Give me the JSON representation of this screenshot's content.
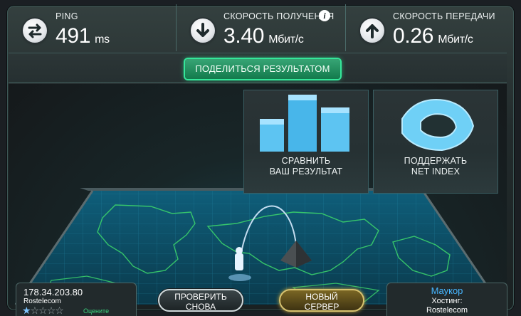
{
  "stats": {
    "ping": {
      "label": "PING",
      "value": "491",
      "unit": "ms",
      "icon": "swap-arrows-icon"
    },
    "download": {
      "label": "СКОРОСТЬ ПОЛУЧЕНИЯ",
      "value": "3.40",
      "unit": "Мбит/с",
      "icon": "arrow-down-icon",
      "info": "i"
    },
    "upload": {
      "label": "СКОРОСТЬ ПЕРЕДАЧИ",
      "value": "0.26",
      "unit": "Мбит/с",
      "icon": "arrow-up-icon"
    }
  },
  "share": {
    "label": "ПОДЕЛИТЬСЯ РЕЗУЛЬТАТОМ"
  },
  "tiles": {
    "compare": {
      "line1": "СРАВНИТЬ",
      "line2": "ВАШ РЕЗУЛЬТАТ",
      "icon": "bar-chart-icon"
    },
    "support": {
      "line1": "ПОДДЕРЖАТЬ",
      "line2": "NET INDEX",
      "icon": "net-index-logo-icon"
    }
  },
  "client": {
    "ip": "178.34.203.80",
    "isp": "Rostelecom",
    "rating_label": "Оцените",
    "stars_total": 5,
    "stars_filled": 1
  },
  "buttons": {
    "retest": {
      "line1": "ПРОВЕРИТЬ",
      "line2": "СНОВА"
    },
    "new_server": {
      "line1": "НОВЫЙ",
      "line2": "СЕРВЕР"
    }
  },
  "server": {
    "city": "Маукор",
    "hosting_label": "Хостинг:",
    "host": "Rostelecom"
  },
  "colors": {
    "accent_green": "#35e69a",
    "accent_gold": "#d7c270",
    "map_line": "#3bd16a",
    "city_blue": "#47b6ff"
  }
}
